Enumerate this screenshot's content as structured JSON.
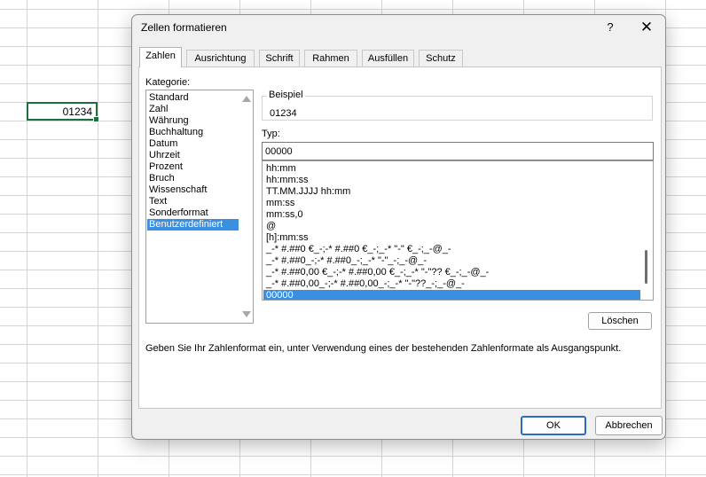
{
  "sheet": {
    "cell_value": "01234",
    "grid_color": "#d6d6d6",
    "cell_border_color": "#1e6e3e"
  },
  "dialog": {
    "title": "Zellen formatieren",
    "help_label": "?",
    "close_label": "✕",
    "tabs": [
      {
        "label": "Zahlen",
        "active": true
      },
      {
        "label": "Ausrichtung",
        "active": false
      },
      {
        "label": "Schrift",
        "active": false
      },
      {
        "label": "Rahmen",
        "active": false
      },
      {
        "label": "Ausfüllen",
        "active": false
      },
      {
        "label": "Schutz",
        "active": false
      }
    ],
    "kategorie_label": "Kategorie:",
    "kategorien": [
      "Standard",
      "Zahl",
      "Währung",
      "Buchhaltung",
      "Datum",
      "Uhrzeit",
      "Prozent",
      "Bruch",
      "Wissenschaft",
      "Text",
      "Sonderformat",
      "Benutzerdefiniert"
    ],
    "selected_kategorie": "Benutzerdefiniert",
    "beispiel_label": "Beispiel",
    "beispiel_value": "01234",
    "typ_label": "Typ:",
    "typ_value": "00000",
    "formats": [
      "hh:mm",
      "hh:mm:ss",
      "TT.MM.JJJJ hh:mm",
      "mm:ss",
      "mm:ss,0",
      "@",
      "[h]:mm:ss",
      "_-* #.##0 €_-;-* #.##0 €_-;_-* \"-\" €_-;_-@_-",
      "_-* #.##0_-;-* #.##0_-;_-* \"-\"_-;_-@_-",
      "_-* #.##0,00 €_-;-* #.##0,00 €_-;_-* \"-\"?? €_-;_-@_-",
      "_-* #.##0,00_-;-* #.##0,00_-;_-* \"-\"??_-;_-@_-",
      "00000"
    ],
    "selected_format": "00000",
    "loeschen_label": "Löschen",
    "hint": "Geben Sie Ihr Zahlenformat ein, unter Verwendung eines der bestehenden Zahlenformate als Ausgangspunkt.",
    "ok_label": "OK",
    "abbrechen_label": "Abbrechen",
    "accent_color": "#3b8fe0"
  }
}
